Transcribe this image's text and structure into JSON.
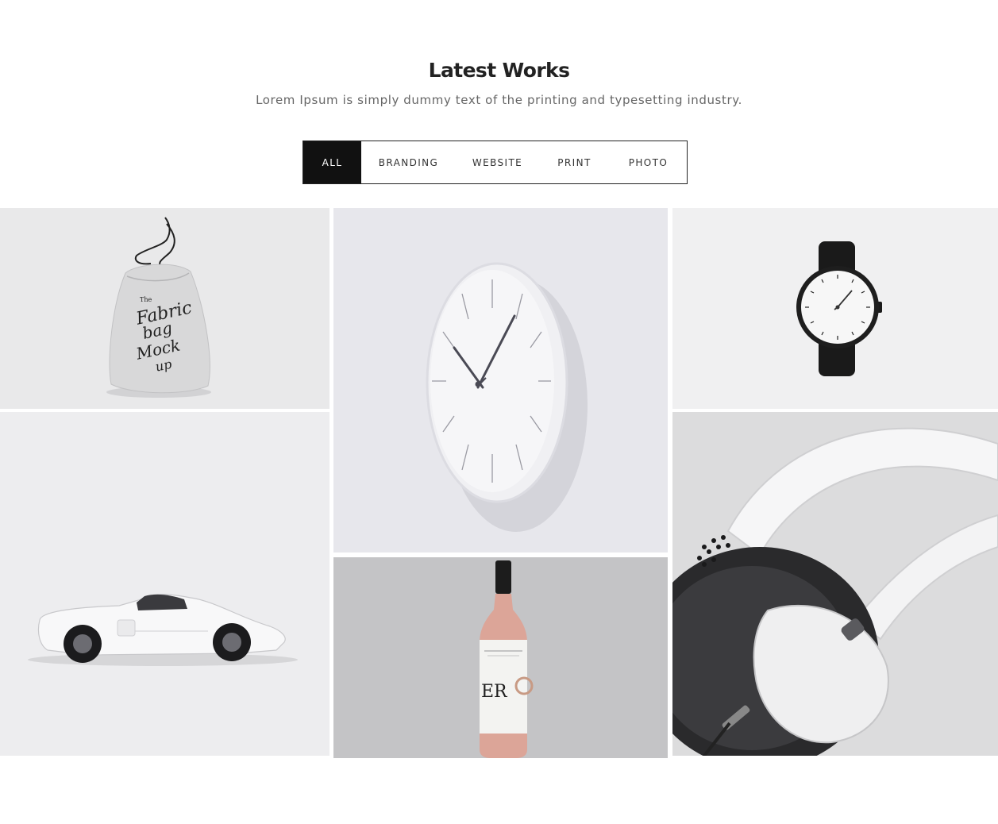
{
  "section": {
    "title": "Latest Works",
    "subtitle": "Lorem Ipsum is simply dummy text of the printing and typesetting industry."
  },
  "filters": [
    {
      "label": "ALL",
      "active": true
    },
    {
      "label": "BRANDING",
      "active": false
    },
    {
      "label": "WEBSITE",
      "active": false
    },
    {
      "label": "PRINT",
      "active": false
    },
    {
      "label": "PHOTO",
      "active": false
    }
  ],
  "portfolio": {
    "items": [
      {
        "name": "fabric-bag-mockup",
        "image_text": [
          "The",
          "Fabric",
          "bag",
          "Mock",
          "up"
        ]
      },
      {
        "name": "wall-clock"
      },
      {
        "name": "wrist-watch"
      },
      {
        "name": "white-race-car"
      },
      {
        "name": "wine-bottle",
        "image_text": "ER"
      },
      {
        "name": "headphones"
      }
    ]
  },
  "colors": {
    "accent": "#111111",
    "background": "#ffffff",
    "tile_bg": "#efeff0"
  }
}
